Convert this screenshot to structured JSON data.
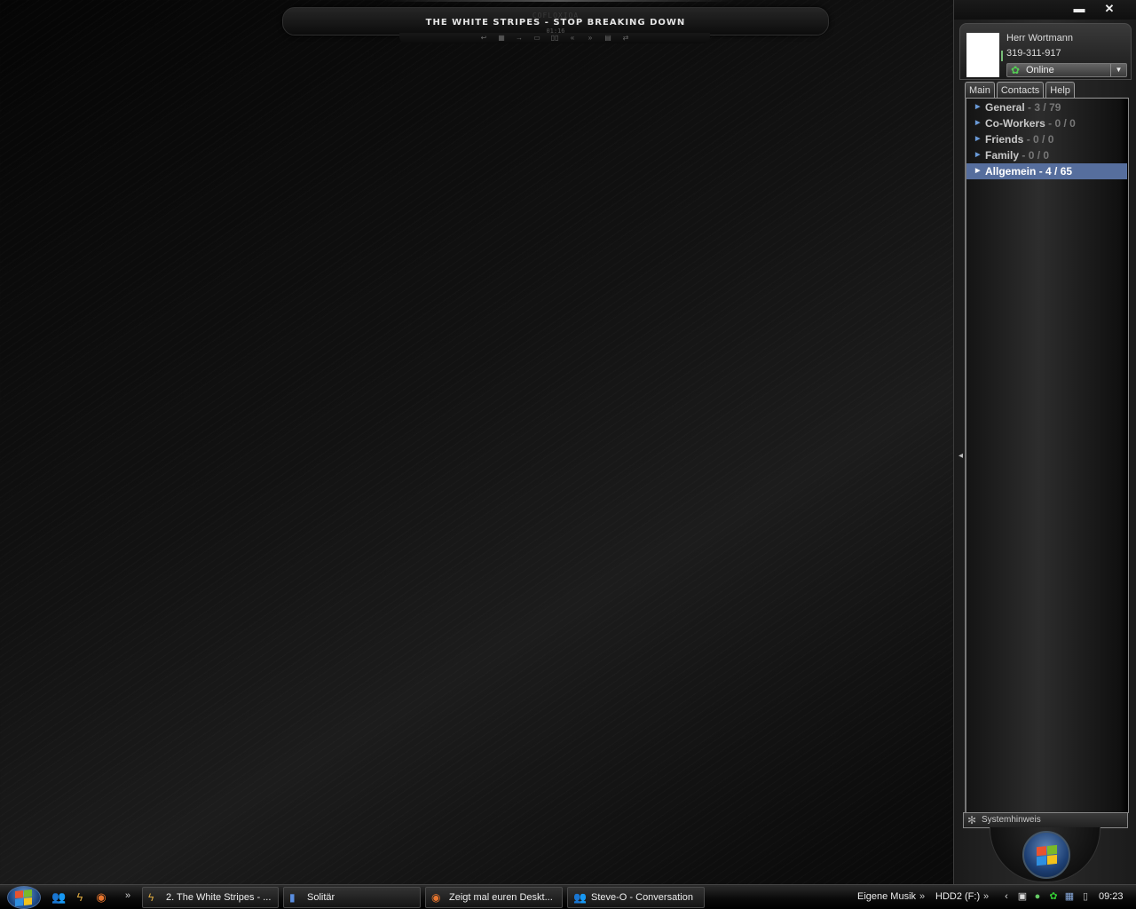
{
  "player": {
    "app_name": "COFLOXIOA",
    "track_title": "THE WHITE STRIPES - STOP BREAKING DOWN",
    "time": "01:16",
    "controls": [
      "↩",
      "▦",
      "→",
      "▭",
      "▯▯",
      "«",
      "»",
      "▤",
      "⇄"
    ]
  },
  "messenger": {
    "window_controls": {
      "minimize": "▬",
      "close": "✕"
    },
    "profile": {
      "name": "Herr Wortmann",
      "number": "319-311-917",
      "status": "Online"
    },
    "tabs": [
      "Main",
      "Contacts",
      "Help"
    ],
    "groups": [
      {
        "name": "General",
        "count": "3 / 79"
      },
      {
        "name": "Co-Workers",
        "count": "0 / 0"
      },
      {
        "name": "Friends",
        "count": "0 / 0"
      },
      {
        "name": "Family",
        "count": "0 / 0"
      },
      {
        "name": "Allgemein",
        "count": "4 / 65"
      }
    ],
    "selected_group": "Allgemein",
    "notification": "Systemhinweis",
    "icons": {
      "status": "flower-status-icon",
      "notification": "gear-icon",
      "group_expand": "triangle-right-icon"
    }
  },
  "taskbar": {
    "quicklaunch_icons": [
      "messenger-people-icon",
      "winamp-icon",
      "firefox-icon"
    ],
    "tasks": [
      {
        "label": "2. The White Stripes - ...",
        "icon": "winamp-icon"
      },
      {
        "label": "Solitär",
        "icon": "cards-icon"
      },
      {
        "label": "Zeigt mal euren Deskt...",
        "icon": "firefox-icon"
      },
      {
        "label": "Steve-O - Conversation",
        "icon": "messenger-people-icon"
      }
    ],
    "toolbars": [
      "Eigene Musik",
      "HDD2 (F:)"
    ],
    "tray_icons": [
      "hide-icons-chevron",
      "monitor-icon",
      "messenger-people-icon",
      "flower-status-icon",
      "network-icon",
      "usb-icon"
    ],
    "clock": "09:23"
  },
  "colors": {
    "selection": "#566e9d",
    "online_green": "#55cc55",
    "orb_blue": "#1e4a86"
  }
}
